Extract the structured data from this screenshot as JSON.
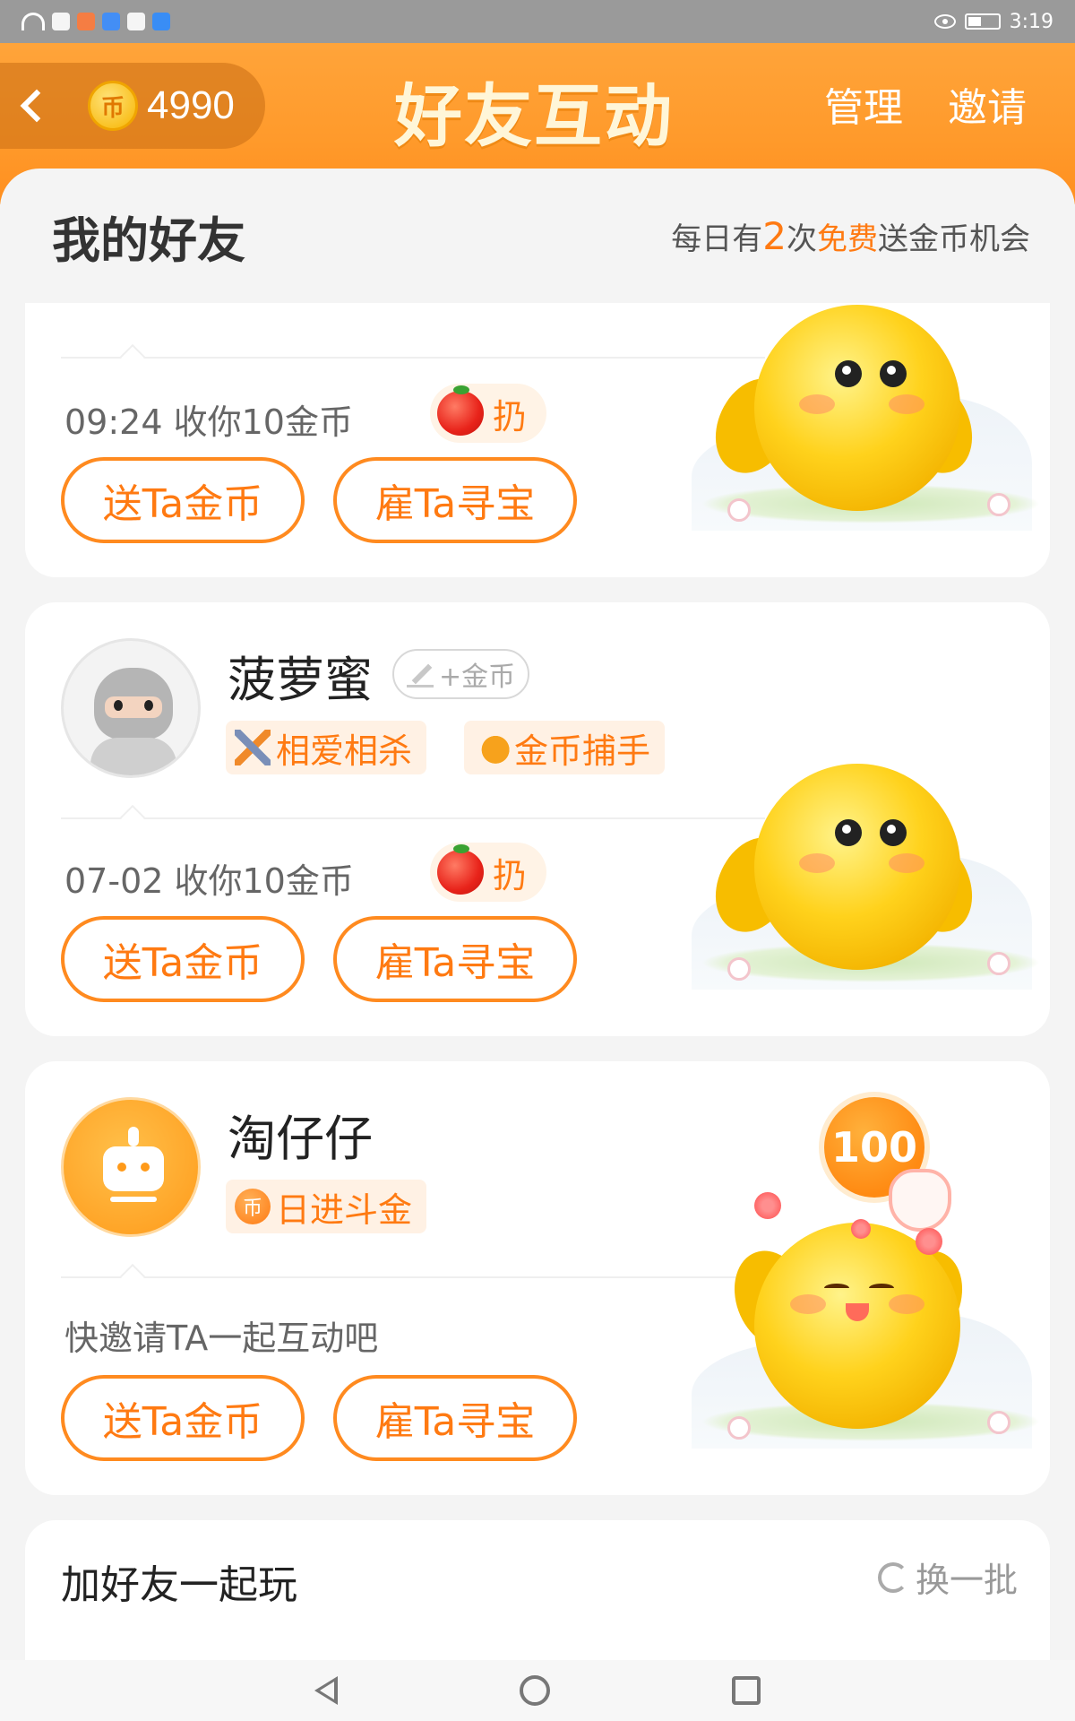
{
  "status_bar": {
    "time": "3:19"
  },
  "header": {
    "coin_count": "4990",
    "coin_glyph": "币",
    "title": "好友互动",
    "manage": "管理",
    "invite": "邀请"
  },
  "friends_header": {
    "title": "我的好友",
    "note_prefix": "每日有",
    "note_count": "2",
    "note_mid": "次",
    "note_free": "免费",
    "note_suffix": "送金币机会"
  },
  "friends": [
    {
      "received": "09:24 收你10金币",
      "throw_label": "扔",
      "send_button": "送Ta金币",
      "hire_button": "雇Ta寻宝"
    },
    {
      "name": "菠萝蜜",
      "edit_label": "+金币",
      "tags": [
        "相爱相杀",
        "金币捕手"
      ],
      "received": "07-02 收你10金币",
      "throw_label": "扔",
      "send_button": "送Ta金币",
      "hire_button": "雇Ta寻宝"
    },
    {
      "name": "淘仔仔",
      "tags": [
        "日进斗金"
      ],
      "tag_coin_glyph": "币",
      "invite_text": "快邀请TA一起互动吧",
      "coin_bubble": "100",
      "send_button": "送Ta金币",
      "hire_button": "雇Ta寻宝"
    }
  ],
  "add_friends": {
    "title": "加好友一起玩",
    "refresh": "换一批"
  },
  "colors": {
    "accent": "#ff7a12",
    "header": "#ff9a2b"
  }
}
